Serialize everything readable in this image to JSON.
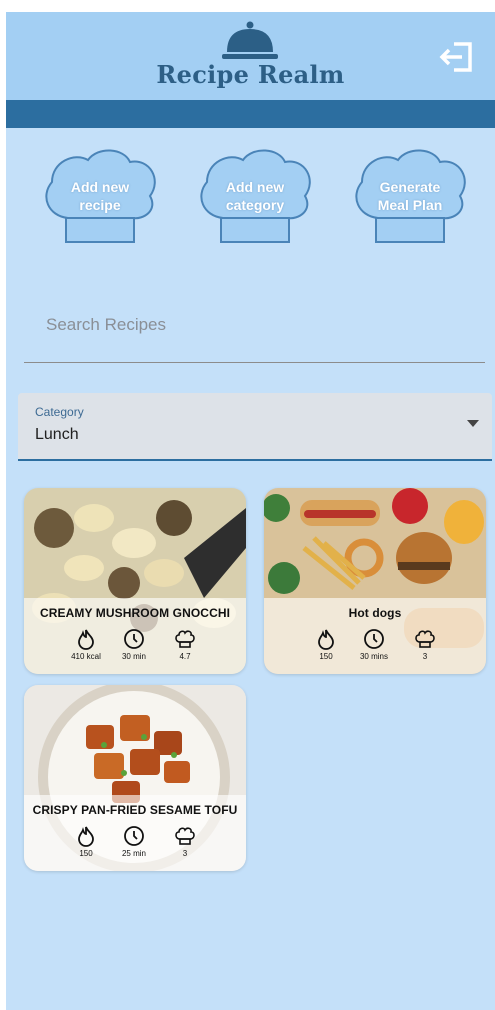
{
  "header": {
    "title": "Recipe Realm",
    "logo_icon": "cloche-icon",
    "logout_icon": "logout-icon"
  },
  "actions": [
    {
      "label_line1": "Add new",
      "label_line2": "recipe"
    },
    {
      "label_line1": "Add new",
      "label_line2": "category"
    },
    {
      "label_line1": "Generate",
      "label_line2": "Meal Plan"
    }
  ],
  "search": {
    "placeholder": "Search Recipes"
  },
  "category": {
    "label": "Category",
    "value": "Lunch"
  },
  "recipes": [
    {
      "title": "CREAMY MUSHROOM GNOCCHI",
      "calories": "410 kcal",
      "time": "30 min",
      "rating": "4.7"
    },
    {
      "title": "Hot dogs",
      "calories": "150",
      "time": "30 mins",
      "rating": "3"
    },
    {
      "title": "CRISPY PAN-FRIED SESAME TOFU",
      "calories": "150",
      "time": "25 min",
      "rating": "3"
    }
  ],
  "colors": {
    "background": "#c4e0f9",
    "header": "#a3cff3",
    "accent": "#2c6ea0",
    "title": "#2d5f86"
  }
}
